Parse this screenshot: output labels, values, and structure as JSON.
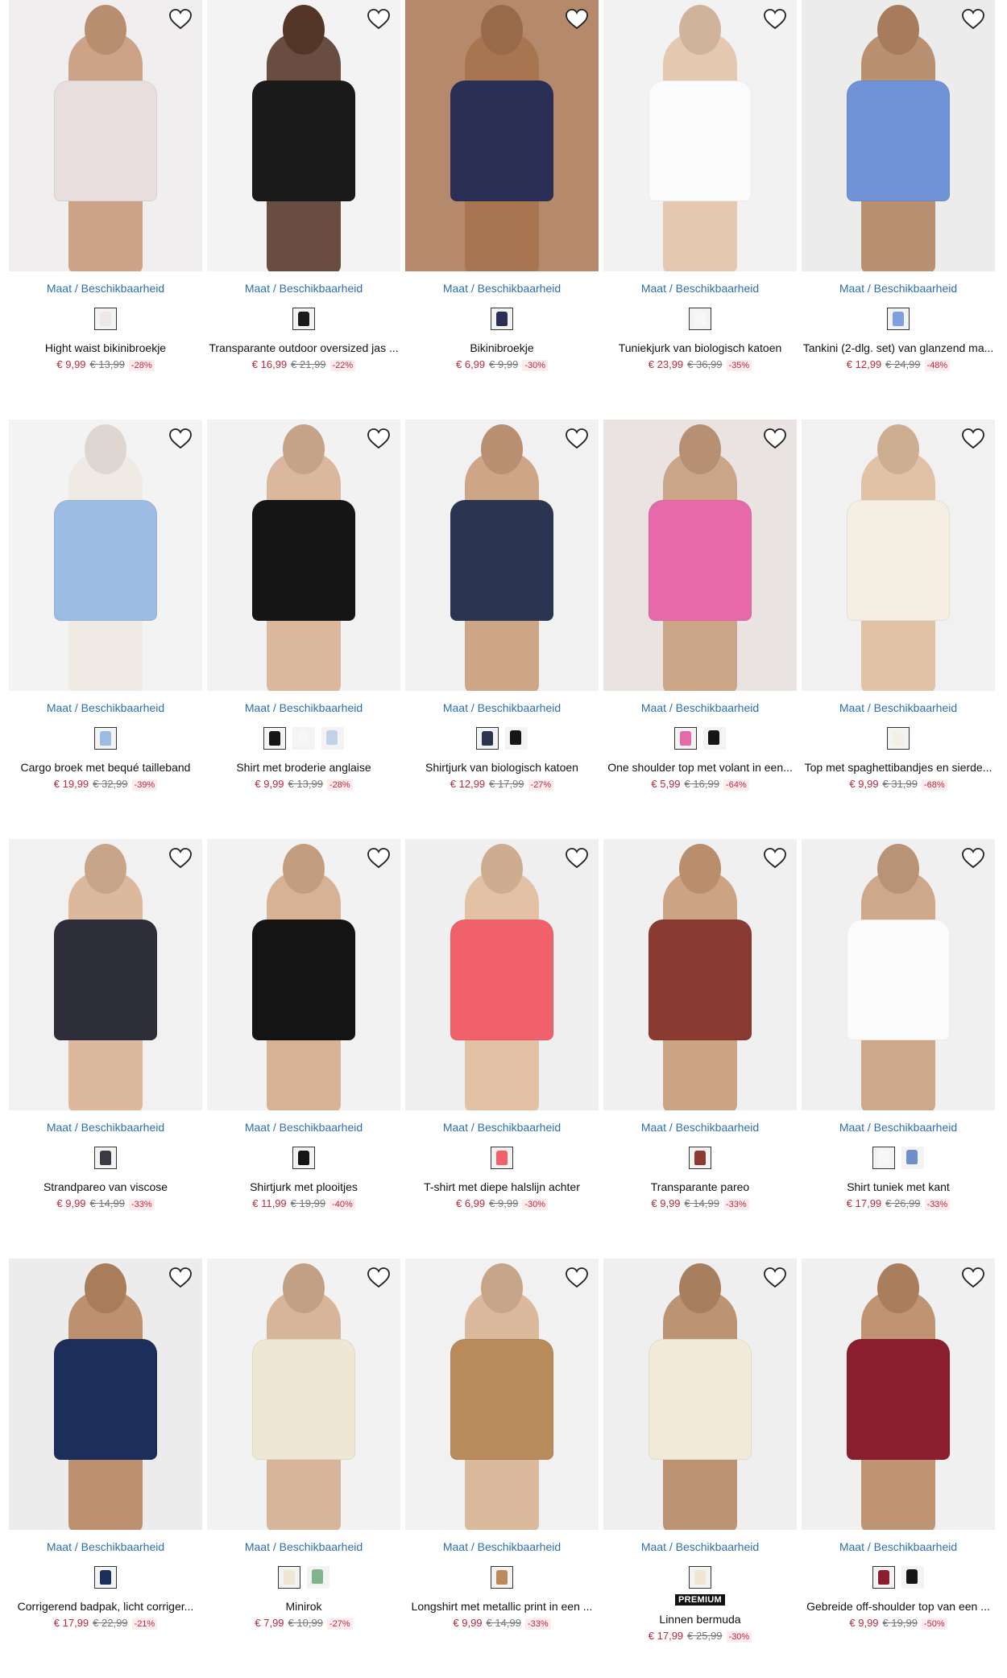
{
  "size_link_label": "Maat / Beschikbaarheid",
  "colors": {
    "accent_link": "#2a6fb3",
    "sale_price": "#c0283b"
  },
  "products": [
    {
      "name": "Hight waist bikinibroekje",
      "price": "€ 9,99",
      "old_price": "€ 13,99",
      "discount": "-28%",
      "bg": "#f0eeee",
      "body": "#c89a7a",
      "cloth": "#e8dede",
      "swatches": [
        "#efe6e6"
      ],
      "favorite_icon": "heart-outline-icon"
    },
    {
      "name": "Transparante outdoor oversized jas ...",
      "price": "€ 16,99",
      "old_price": "€ 21,99",
      "discount": "-22%",
      "bg": "#f3f3f3",
      "body": "#5a3b2c",
      "cloth": "#1a1a1a",
      "swatches": [
        "#1a1a1a"
      ],
      "favorite_icon": "heart-outline-icon"
    },
    {
      "name": "Bikinibroekje",
      "price": "€ 6,99",
      "old_price": "€ 9,99",
      "discount": "-30%",
      "bg": "#b58a6c",
      "body": "#a5734f",
      "cloth": "#2a2f55",
      "swatches": [
        "#2a2f55"
      ],
      "favorite_icon": "heart-outline-icon"
    },
    {
      "name": "Tuniekjurk van biologisch katoen",
      "price": "€ 23,99",
      "old_price": "€ 36,99",
      "discount": "-35%",
      "bg": "#f2f2f2",
      "body": "#e2c3a8",
      "cloth": "#fbfbfb",
      "swatches": [
        "#f7f7f7"
      ],
      "favorite_icon": "heart-outline-icon"
    },
    {
      "name": "Tankini (2-dlg. set) van glanzend ma...",
      "price": "€ 12,99",
      "old_price": "€ 24,99",
      "discount": "-48%",
      "bg": "#ececec",
      "body": "#b48764",
      "cloth": "#6f93d6",
      "swatches": [
        "#7ea0e0"
      ],
      "favorite_icon": "heart-outline-icon"
    },
    {
      "name": "Cargo broek met bequé tailleband",
      "price": "€ 19,99",
      "old_price": "€ 32,99",
      "discount": "-39%",
      "bg": "#f3f3f3",
      "body": "#f0e9e3",
      "cloth": "#9dbce3",
      "swatches": [
        "#9dbce3"
      ],
      "favorite_icon": "heart-outline-icon"
    },
    {
      "name": "Shirt met broderie anglaise",
      "price": "€ 9,99",
      "old_price": "€ 13,99",
      "discount": "-28%",
      "bg": "#f2f2f2",
      "body": "#d7b093",
      "cloth": "#151515",
      "swatches": [
        "#151515",
        "#f7f7f7",
        "#c2d2ea"
      ],
      "favorite_icon": "heart-outline-icon"
    },
    {
      "name": "Shirtjurk van biologisch katoen",
      "price": "€ 12,99",
      "old_price": "€ 17,99",
      "discount": "-27%",
      "bg": "#f1f1f1",
      "body": "#c99c7b",
      "cloth": "#2b3552",
      "swatches": [
        "#2b3552",
        "#151515"
      ],
      "favorite_icon": "heart-outline-icon"
    },
    {
      "name": "One shoulder top met volant in een...",
      "price": "€ 5,99",
      "old_price": "€ 16,99",
      "discount": "-64%",
      "bg": "#e9e4e2",
      "body": "#c79d7e",
      "cloth": "#e66aa9",
      "swatches": [
        "#e66aa9",
        "#151515"
      ],
      "favorite_icon": "heart-outline-icon"
    },
    {
      "name": "Top met spaghettibandjes en sierde...",
      "price": "€ 9,99",
      "old_price": "€ 31,99",
      "discount": "-68%",
      "bg": "#f1f1f1",
      "body": "#e0bd9e",
      "cloth": "#f4efe2",
      "swatches": [
        "#f4efe2"
      ],
      "favorite_icon": "heart-outline-icon"
    },
    {
      "name": "Strandpareo van viscose",
      "price": "€ 9,99",
      "old_price": "€ 14,99",
      "discount": "-33%",
      "bg": "#f1f1f1",
      "body": "#d9b294",
      "cloth": "#2e2e3a",
      "swatches": [
        "#3a3a44"
      ],
      "favorite_icon": "heart-outline-icon"
    },
    {
      "name": "Shirtjurk met plooitjes",
      "price": "€ 11,99",
      "old_price": "€ 19,99",
      "discount": "-40%",
      "bg": "#f2f2f2",
      "body": "#d4ab8b",
      "cloth": "#141414",
      "swatches": [
        "#141414"
      ],
      "favorite_icon": "heart-outline-icon"
    },
    {
      "name": "T-shirt met diepe halslijn achter",
      "price": "€ 6,99",
      "old_price": "€ 9,99",
      "discount": "-30%",
      "bg": "#efefef",
      "body": "#e0bb9c",
      "cloth": "#f0616b",
      "swatches": [
        "#f0616b"
      ],
      "favorite_icon": "heart-outline-icon"
    },
    {
      "name": "Transparante pareo",
      "price": "€ 9,99",
      "old_price": "€ 14,99",
      "discount": "-33%",
      "bg": "#f0f0f0",
      "body": "#c89a77",
      "cloth": "#8a3a30",
      "swatches": [
        "#8a3a30"
      ],
      "favorite_icon": "heart-outline-icon"
    },
    {
      "name": "Shirt tuniek met kant",
      "price": "€ 17,99",
      "old_price": "€ 26,99",
      "discount": "-33%",
      "bg": "#f0f0f0",
      "body": "#c9a080",
      "cloth": "#fbfbfb",
      "swatches": [
        "#f7f7f7",
        "#6f8fc9"
      ],
      "favorite_icon": "heart-outline-icon"
    },
    {
      "name": "Corrigerend badpak, licht corriger...",
      "price": "€ 17,99",
      "old_price": "€ 22,99",
      "discount": "-21%",
      "bg": "#ececec",
      "body": "#b88762",
      "cloth": "#1c2e5a",
      "swatches": [
        "#1c2e5a"
      ],
      "favorite_icon": "heart-outline-icon"
    },
    {
      "name": "Minirok",
      "price": "€ 7,99",
      "old_price": "€ 10,99",
      "discount": "-27%",
      "bg": "#f2f2f2",
      "body": "#d3ae90",
      "cloth": "#efe6d4",
      "swatches": [
        "#efe6d4",
        "#7fb58a"
      ],
      "favorite_icon": "heart-outline-icon"
    },
    {
      "name": "Longshirt met metallic print in een ...",
      "price": "€ 9,99",
      "old_price": "€ 14,99",
      "discount": "-33%",
      "bg": "#f1f1f1",
      "body": "#d7b394",
      "cloth": "#b98a5b",
      "swatches": [
        "#b98a5b"
      ],
      "favorite_icon": "heart-outline-icon"
    },
    {
      "name": "Linnen bermuda",
      "price": "€ 17,99",
      "old_price": "€ 25,99",
      "discount": "-30%",
      "bg": "#efefef",
      "body": "#b68a66",
      "cloth": "#f1ead9",
      "swatches": [
        "#efe6d4"
      ],
      "premium": "PREMIUM",
      "favorite_icon": "heart-outline-icon"
    },
    {
      "name": "Gebreide off-shoulder top van een ...",
      "price": "€ 9,99",
      "old_price": "€ 19,99",
      "discount": "-50%",
      "bg": "#f0f0f0",
      "body": "#b88965",
      "cloth": "#8a1e2f",
      "swatches": [
        "#8a1e2f",
        "#151515"
      ],
      "favorite_icon": "heart-outline-icon"
    }
  ]
}
